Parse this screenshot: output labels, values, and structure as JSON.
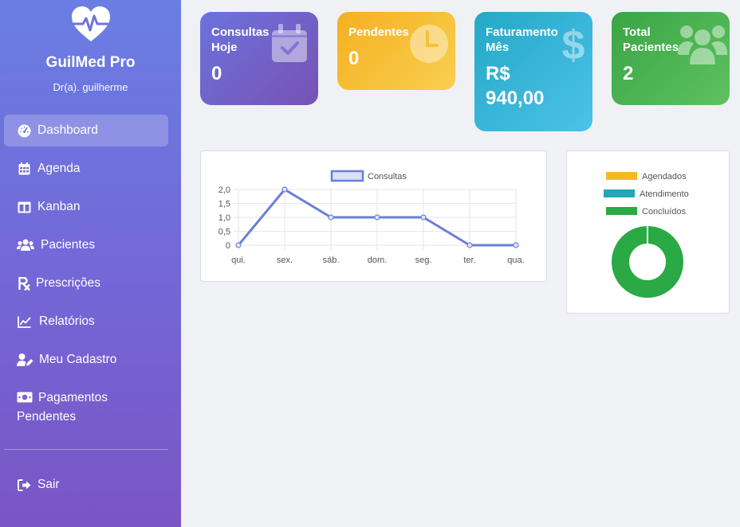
{
  "brand": {
    "name": "GuilMed Pro",
    "user": "Dr(a). guilherme"
  },
  "nav": {
    "items": [
      {
        "label": "Dashboard",
        "icon": "dashboard-gauge-icon",
        "active": true
      },
      {
        "label": "Agenda",
        "icon": "calendar-icon"
      },
      {
        "label": "Kanban",
        "icon": "kanban-columns-icon"
      },
      {
        "label": "Pacientes",
        "icon": "users-icon"
      },
      {
        "label": "Prescrições",
        "icon": "prescription-rx-icon"
      },
      {
        "label": "Relatórios",
        "icon": "line-chart-icon"
      },
      {
        "label": "Meu Cadastro",
        "icon": "user-edit-icon"
      },
      {
        "label": "Pagamentos Pendentes",
        "icon": "money-bill-icon"
      }
    ],
    "logout": {
      "label": "Sair",
      "icon": "sign-out-icon"
    }
  },
  "cards": [
    {
      "label": "Consultas Hoje",
      "value": "0",
      "icon": "calendar-check-icon",
      "color": "#6b73dc"
    },
    {
      "label": "Pendentes",
      "value": "0",
      "icon": "clock-icon",
      "color": "#f5b020"
    },
    {
      "label": "Faturamento Mês",
      "value": "R$ 940,00",
      "icon": "dollar-icon",
      "color": "#25a8c8"
    },
    {
      "label": "Total Pacientes",
      "value": "2",
      "icon": "users-icon",
      "color": "#3aa545"
    }
  ],
  "chart_data": [
    {
      "type": "line",
      "categories": [
        "qui.",
        "sex.",
        "sáb.",
        "dom.",
        "seg.",
        "ter.",
        "qua."
      ],
      "series": [
        {
          "name": "Consultas",
          "values": [
            0,
            2,
            1,
            1,
            1,
            0,
            0
          ],
          "color": "#6a7fd8"
        }
      ],
      "y_ticks": [
        "0",
        "0,5",
        "1,0",
        "1,5",
        "2,0"
      ],
      "ylim": [
        0,
        2
      ],
      "grid": true,
      "legend": "top"
    },
    {
      "type": "pie",
      "variant": "doughnut",
      "labels": [
        "Agendados",
        "Atendimento",
        "Concluídos"
      ],
      "values": [
        0,
        0,
        1
      ],
      "colors": [
        "#f5b920",
        "#22a6b8",
        "#2aa944"
      ],
      "legend": "top"
    }
  ]
}
